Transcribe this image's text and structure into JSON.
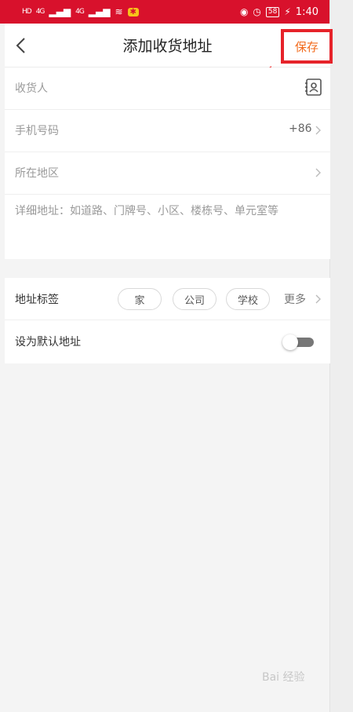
{
  "status_bar": {
    "left_badges": [
      "HD",
      "HD"
    ],
    "signal_1": "4G",
    "signal_2": "4G",
    "battery": "58",
    "time": "1:40"
  },
  "header": {
    "title": "添加收货地址",
    "save_label": "保存"
  },
  "form": {
    "recipient_placeholder": "收货人",
    "phone_placeholder": "手机号码",
    "phone_prefix": "+86",
    "region_placeholder": "所在地区",
    "detail_placeholder": "详细地址：如道路、门牌号、小区、楼栋号、单元室等"
  },
  "tags": {
    "label": "地址标签",
    "options": [
      "家",
      "公司",
      "学校"
    ],
    "more_label": "更多"
  },
  "default_address": {
    "label": "设为默认地址",
    "enabled": false
  },
  "colors": {
    "status_bar": "#d8112c",
    "save_text": "#f26b1d",
    "highlight_box": "#e6232a"
  },
  "watermark": "Bai 经验"
}
